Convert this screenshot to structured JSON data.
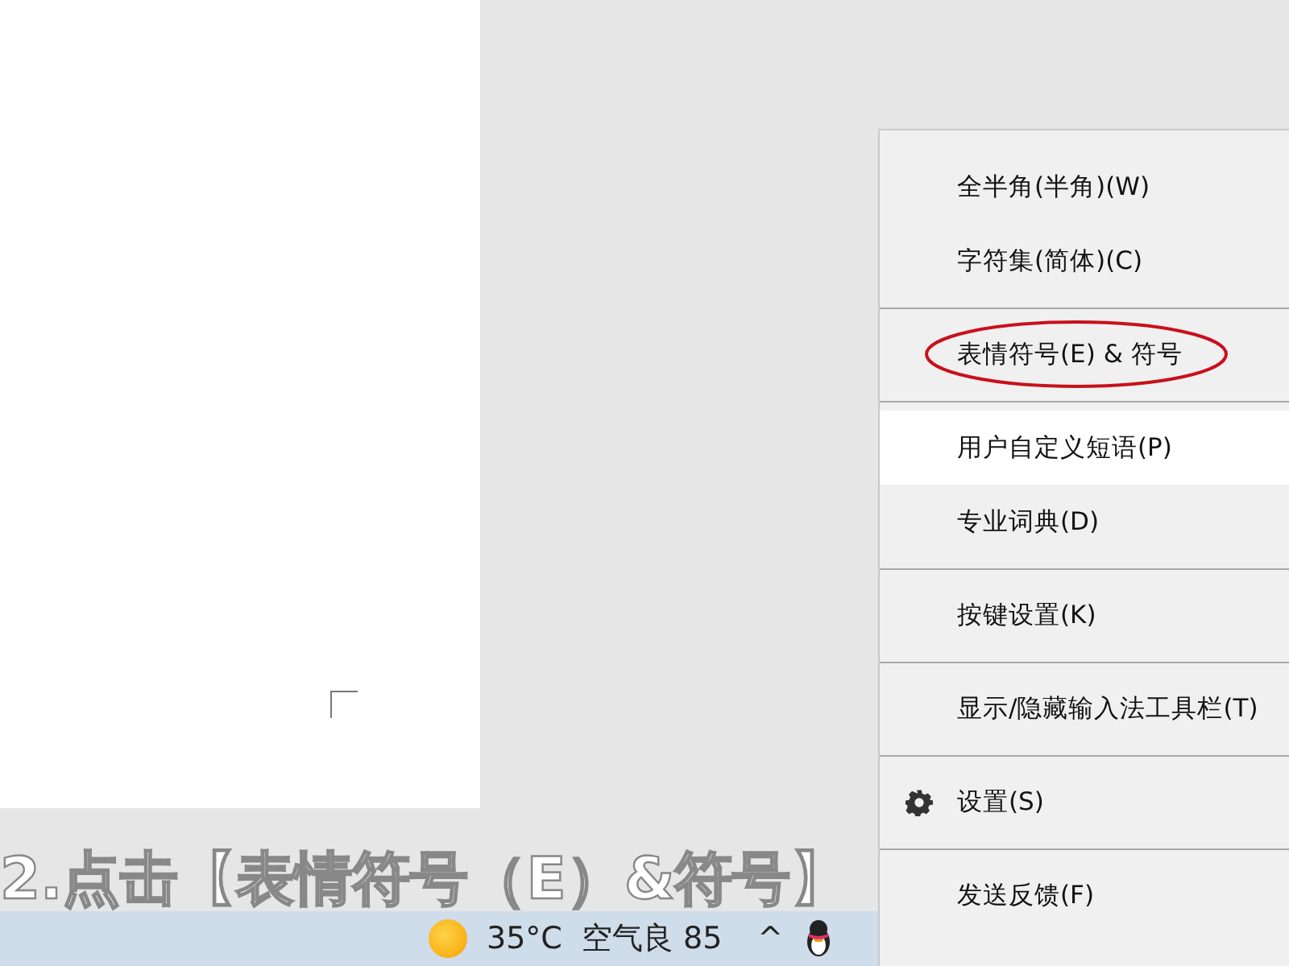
{
  "subtitle": "2.点击【表情符号（E）&符号】",
  "taskbar": {
    "temperature": "35°C",
    "air_quality": "空气良 85",
    "tray_chevron": "^"
  },
  "menu": {
    "groups": [
      [
        {
          "label": "全半角(半角)(W)",
          "selected": false,
          "annotated": false,
          "kind": "plain"
        },
        {
          "label": "字符集(简体)(C)",
          "selected": false,
          "annotated": false,
          "kind": "plain"
        }
      ],
      [
        {
          "label": "表情符号(E) & 符号",
          "selected": false,
          "annotated": true,
          "kind": "plain"
        }
      ],
      [
        {
          "label": "用户自定义短语(P)",
          "selected": true,
          "annotated": false,
          "kind": "plain"
        },
        {
          "label": "专业词典(D)",
          "selected": false,
          "annotated": false,
          "kind": "plain"
        }
      ],
      [
        {
          "label": "按键设置(K)",
          "selected": false,
          "annotated": false,
          "kind": "plain"
        }
      ],
      [
        {
          "label": "显示/隐藏输入法工具栏(T)",
          "selected": false,
          "annotated": false,
          "kind": "plain"
        }
      ],
      [
        {
          "label": "设置(S)",
          "selected": false,
          "annotated": false,
          "kind": "gear"
        }
      ],
      [
        {
          "label": "发送反馈(F)",
          "selected": false,
          "annotated": false,
          "kind": "plain"
        }
      ]
    ]
  }
}
